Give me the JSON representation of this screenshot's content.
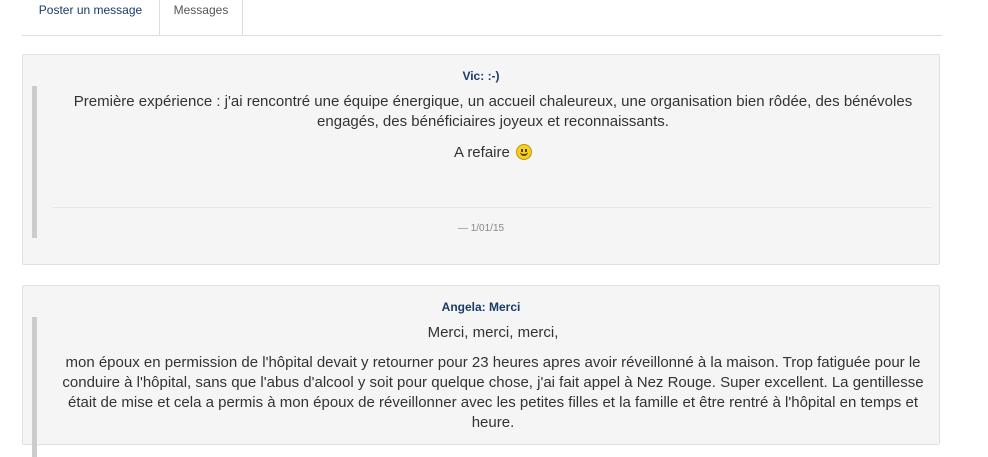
{
  "tabs": {
    "post_message": "Poster un message",
    "messages": "Messages"
  },
  "posts": [
    {
      "title": "Vic: :-)",
      "paragraphs": [
        "Première expérience : j'ai rencontré une équipe énergique, un accueil chaleureux, une organisation bien rôdée, des bénévoles engagés, des bénéficiaires joyeux et reconnaissants.",
        "A refaire"
      ],
      "emoticon": "smiley-icon",
      "date": "— 1/01/15"
    },
    {
      "title": "Angela: Merci",
      "paragraphs": [
        "Merci, merci, merci,",
        "mon époux en permission de l'hôpital devait y retourner pour 23 heures apres avoir réveillonné à la maison. Trop fatiguée pour le conduire à l'hôpital, sans que l'abus d'alcool y soit pour quelque chose, j'ai fait appel à Nez Rouge. Super excellent. La gentillesse était de mise et cela a permis à mon époux de réveillonner avec les petites filles et la famille et être rentré à l'hôpital en temps et heure."
      ]
    }
  ]
}
